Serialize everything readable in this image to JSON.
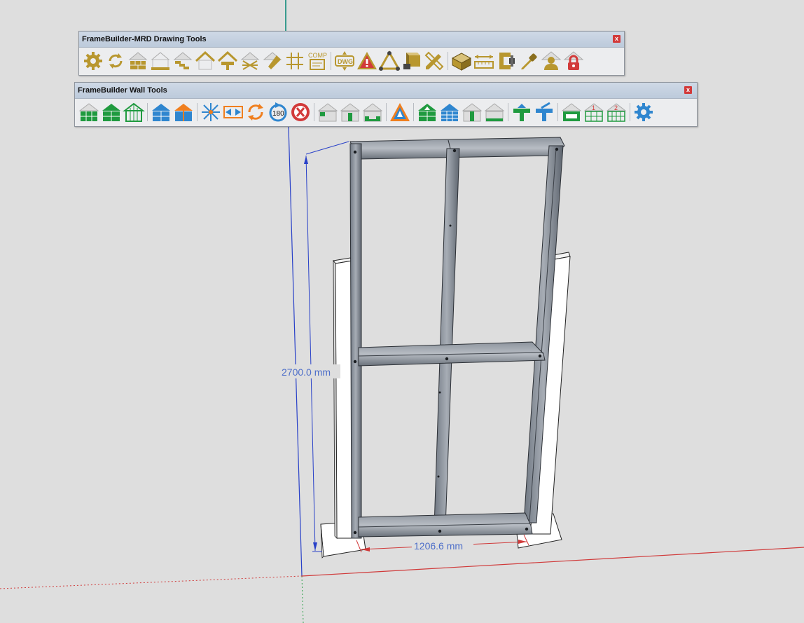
{
  "colors": {
    "gold": "#b8972f",
    "green": "#1f9a3f",
    "blue": "#2f86cf",
    "red": "#d23a3a",
    "orange": "#f07f1f",
    "canvas": "#dedede",
    "axis_red": "#d03a3a",
    "axis_blue": "#2840c8",
    "axis_green": "#2ea04a",
    "dimension_text": "#4d6ec9"
  },
  "toolbars": {
    "drawing": {
      "title": "FrameBuilder-MRD Drawing Tools",
      "close_label": "x",
      "comp_label": "COMP",
      "dwg_label": "DWG",
      "icons": [
        "gear-icon",
        "refresh-icon",
        "wall-panel-icon",
        "floor-icon",
        "stair-icon",
        "roof-outline-icon",
        "roof-truss-icon",
        "roof-cross-icon",
        "roof-hip-icon",
        "grid-icon",
        "comp-card-icon",
        "dwg-export-icon",
        "warning-icon",
        "triangle-tool-icon",
        "layer-brush-icon",
        "pencil-ruler-icon",
        "package-icon",
        "measure-icon",
        "clamp-icon",
        "eyedropper-icon",
        "user-icon",
        "lock-icon"
      ]
    },
    "wall": {
      "title": "FrameBuilder Wall Tools",
      "close_label": "x",
      "rotate_label": "180",
      "number_one": "1",
      "number_two": "2",
      "icons": [
        "wall-green-1-icon",
        "wall-green-2-icon",
        "wall-gable-green-icon",
        "wall-blue-1-icon",
        "wall-blue-split-icon",
        "explode-icon",
        "stretch-icon",
        "rotate-orange-icon",
        "rotate-180-icon",
        "delete-icon",
        "opening-1-icon",
        "opening-2-icon",
        "opening-3-icon",
        "triangle-wall-icon",
        "wall-green-arrow-icon",
        "wall-blue-arrow-icon",
        "wall-half-icon",
        "wall-bottom-icon",
        "tee-green-icon",
        "tee-blue-icon",
        "lintel-icon",
        "grid-wall-1-icon",
        "grid-wall-2-icon",
        "settings-icon"
      ]
    }
  },
  "dimensions": {
    "height_label": "2700.0 mm",
    "width_label": "1206.6 mm"
  }
}
